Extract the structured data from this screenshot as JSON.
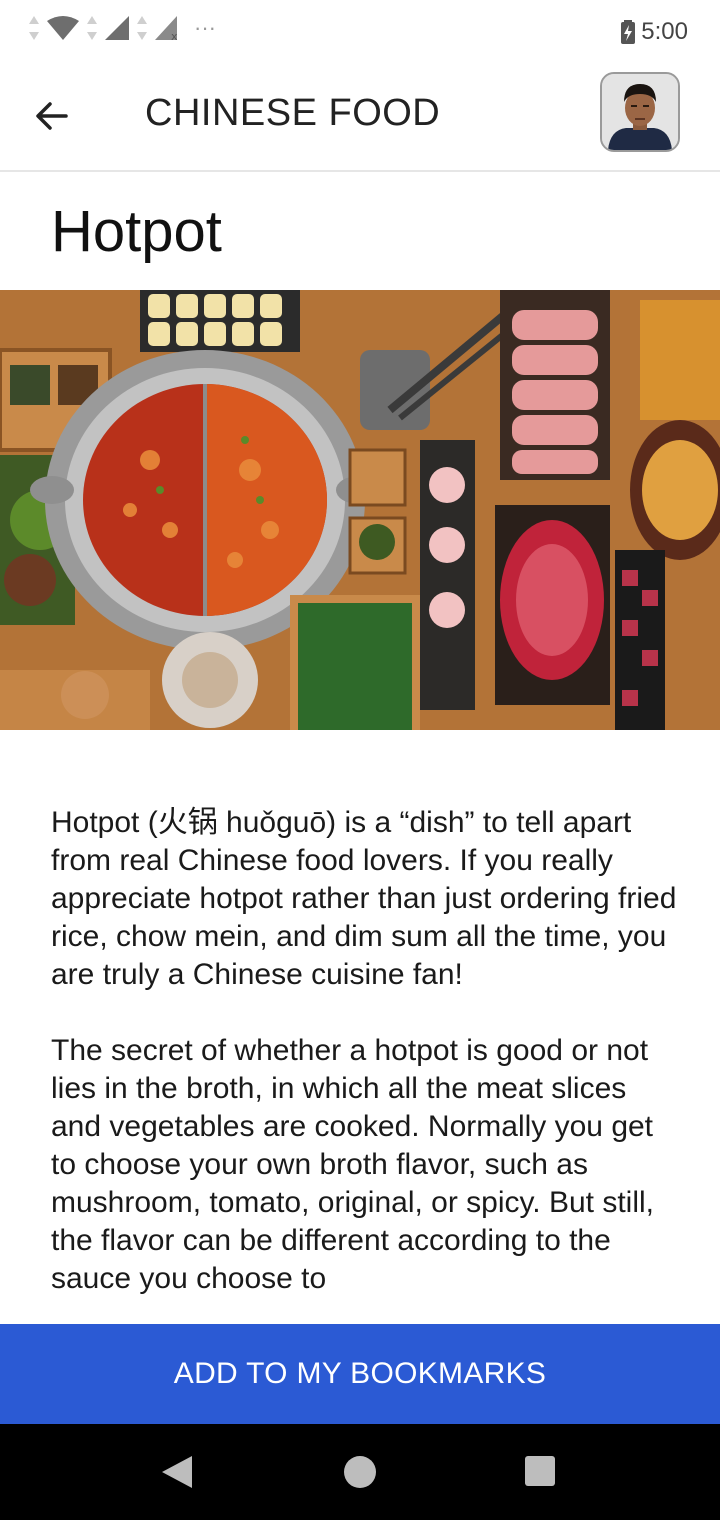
{
  "status_bar": {
    "time": "5:00",
    "icons": [
      "data-arrows-icon",
      "wifi-icon",
      "signal-icon",
      "signal-no-service-icon",
      "more-dots-icon",
      "battery-charging-icon"
    ],
    "more": "···"
  },
  "app_bar": {
    "title": "CHINESE FOOD",
    "back_icon": "arrow-left-icon",
    "avatar": "user-avatar"
  },
  "article": {
    "title": "Hotpot",
    "image": "hotpot-spread-photo",
    "paragraph_1": "Hotpot (火锅 huǒguō) is a “dish” to tell apart from real Chinese food lovers. If you really appreciate hotpot rather than just ordering fried rice, chow mein, and dim sum all the time, you are truly a Chinese cuisine fan!",
    "paragraph_2": "The secret of whether a hotpot is good or not lies in the broth, in which all the meat slices and vegetables are cooked. Normally you get to choose your own broth flavor, such as mushroom, tomato, original, or spicy. But still, the flavor can be different according to the sauce you choose to"
  },
  "bookmark_button": {
    "label": "ADD TO MY BOOKMARKS",
    "color": "#2b5ad4"
  },
  "nav_bar": {
    "icons": [
      "nav-back-icon",
      "nav-home-icon",
      "nav-recents-icon"
    ]
  }
}
